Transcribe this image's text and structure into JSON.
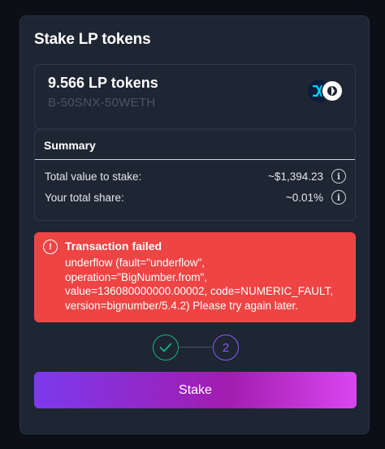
{
  "modal": {
    "title": "Stake LP tokens"
  },
  "token": {
    "amount": "9.566 LP tokens",
    "name": "B-50SNX-50WETH",
    "icons": [
      "snx-icon",
      "weth-icon"
    ]
  },
  "summary": {
    "title": "Summary",
    "rows": [
      {
        "label": "Total value to stake:",
        "value": "~$1,394.23"
      },
      {
        "label": "Your total share:",
        "value": "~0.01%"
      }
    ]
  },
  "alert": {
    "title": "Transaction failed",
    "message": "underflow (fault=\"underflow\", operation=\"BigNumber.from\", value=136080000000.00002, code=NUMERIC_FAULT, version=bignumber/5.4.2) Please try again later.",
    "color": "#ef4444"
  },
  "stepper": {
    "step1_state": "complete",
    "step2_label": "2"
  },
  "stake_button": {
    "label": "Stake"
  },
  "colors": {
    "background": "#0c0f16",
    "card": "#1e2533",
    "success": "#10b981",
    "accent": "#8b5cf6",
    "button_gradient_start": "#7c3aed",
    "button_gradient_end": "#d946ef"
  }
}
